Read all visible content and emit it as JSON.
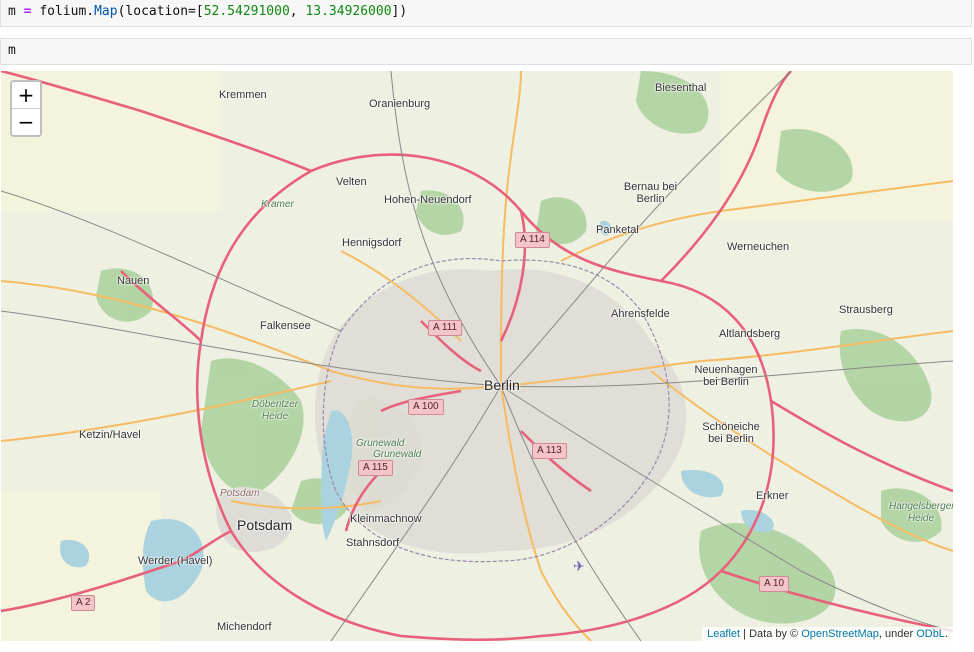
{
  "notebook": {
    "code_cell": {
      "var": "m",
      "op": " = ",
      "module": "folium.",
      "func": "Map",
      "open": "(location=[",
      "lat": "52.54291000",
      "sep": ", ",
      "lon": "13.34926000",
      "close": "])"
    },
    "output_cell": {
      "text": "m"
    }
  },
  "map": {
    "zoom_in": "+",
    "zoom_out": "−",
    "attribution": {
      "leaflet": "Leaflet",
      "mid": " | Data by © ",
      "osm": "OpenStreetMap",
      "under": ", under ",
      "odbl": "ODbL",
      "end": "."
    },
    "places": {
      "kremmen": "Kremmen",
      "oranienburg": "Oranienburg",
      "biesenthal": "Biesenthal",
      "velten": "Velten",
      "hohen_neuendorf": "Hohen-Neuendorf",
      "bernau": "Bernau bei Berlin",
      "kramer": "Kramer",
      "panketal": "Panketal",
      "hennigsdorf": "Hennigsdorf",
      "werneuchen": "Werneuchen",
      "nauen": "Nauen",
      "ahrensfelde": "Ahrensfelde",
      "strausberg": "Strausberg",
      "falkensee": "Falkensee",
      "altlandsberg": "Altlandsberg",
      "berlin": "Berlin",
      "neuenhagen": "Neuenhagen bei Berlin",
      "doberitzer": "Döberitzer Heide",
      "ketzin": "Ketzin/Havel",
      "schoneiche": "Schöneiche bei Berlin",
      "grunewald1": "Grunewald",
      "grunewald2": "Grunewald",
      "potsdam_small": "Potsdam",
      "erkner": "Erkner",
      "hangelsberger": "Hangelsberger Heide",
      "potsdam": "Potsdam",
      "kleinmachnow": "Kleinmachnow",
      "stahnsdorf": "Stahnsdorf",
      "werder": "Werder (Havel)",
      "michendorf": "Michendorf"
    },
    "highways": {
      "a114": "A 114",
      "a111": "A 111",
      "a100": "A 100",
      "a113": "A 113",
      "a115": "A 115",
      "a10": "A 10",
      "a2": "A 2"
    }
  }
}
